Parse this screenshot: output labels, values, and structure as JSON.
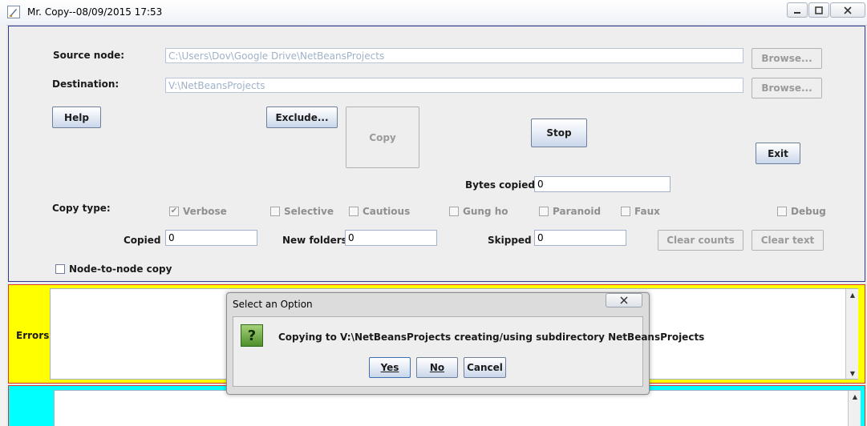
{
  "window": {
    "title": "Mr. Copy--08/09/2015 17:53",
    "minimize_icon": "minimize-icon",
    "maximize_icon": "maximize-icon",
    "close_icon": "close-icon"
  },
  "source": {
    "label": "Source node:",
    "value": "C:\\Users\\Dov\\Google Drive\\NetBeansProjects",
    "browse_label": "Browse..."
  },
  "destination": {
    "label": "Destination:",
    "value": "V:\\NetBeansProjects",
    "browse_label": "Browse..."
  },
  "buttons": {
    "help": "Help",
    "exclude": "Exclude...",
    "copy": "Copy",
    "stop": "Stop",
    "exit": "Exit",
    "clear_counts": "Clear counts",
    "clear_text": "Clear text"
  },
  "bytes_copied": {
    "label": "Bytes copied:",
    "value": "0"
  },
  "copy_type": {
    "label": "Copy type:",
    "options": [
      {
        "label": "Verbose",
        "checked": true
      },
      {
        "label": "Selective",
        "checked": false
      },
      {
        "label": "Cautious",
        "checked": false
      },
      {
        "label": "Gung ho",
        "checked": false
      },
      {
        "label": "Paranoid",
        "checked": false
      },
      {
        "label": "Faux",
        "checked": false
      },
      {
        "label": "Debug",
        "checked": false
      }
    ]
  },
  "counts": {
    "copied_label": "Copied",
    "copied_value": "0",
    "new_folders_label": "New folders",
    "new_folders_value": "0",
    "skipped_label": "Skipped",
    "skipped_value": "0"
  },
  "node_to_node": {
    "label": "Node-to-node copy",
    "checked": false
  },
  "errors": {
    "label": "Errors"
  },
  "dialog": {
    "title": "Select an Option",
    "message": "Copying to V:\\NetBeansProjects creating/using subdirectory NetBeansProjects",
    "icon": "question-icon",
    "icon_glyph": "?",
    "yes": "Yes",
    "no": "No",
    "cancel": "Cancel"
  },
  "colors": {
    "errors_bg": "#ffff00",
    "output_bg": "#00ffff",
    "panel_border": "#2f3a8f",
    "alert_border": "#d53a2a"
  }
}
